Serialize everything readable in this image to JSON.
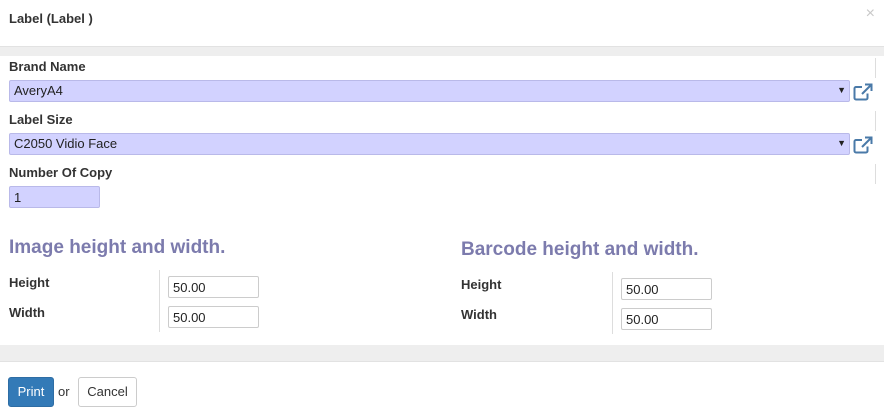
{
  "dialog": {
    "title": "Label (Label )",
    "close_icon": "×"
  },
  "form": {
    "brand_name": {
      "label": "Brand Name",
      "value": "AveryA4",
      "arrow": "▼"
    },
    "label_size": {
      "label": "Label Size",
      "value": "C2050 Vidio Face",
      "arrow": "▼"
    },
    "number_of_copy": {
      "label": "Number Of Copy",
      "value": "1"
    }
  },
  "image_section": {
    "title": "Image height and width.",
    "height_label": "Height",
    "width_label": "Width",
    "height_value": "50.00",
    "width_value": "50.00"
  },
  "barcode_section": {
    "title": "Barcode height and width.",
    "height_label": "Height",
    "width_label": "Width",
    "height_value": "50.00",
    "width_value": "50.00"
  },
  "footer": {
    "print_label": "Print",
    "or_text": "or",
    "cancel_label": "Cancel"
  },
  "colors": {
    "primary": "#337ab7",
    "required_field_bg": "#d2d2ff",
    "section_title": "#7c7bad"
  },
  "icons": {
    "external_link": "external-link-icon",
    "close": "close-icon",
    "dropdown": "caret-down-icon"
  }
}
